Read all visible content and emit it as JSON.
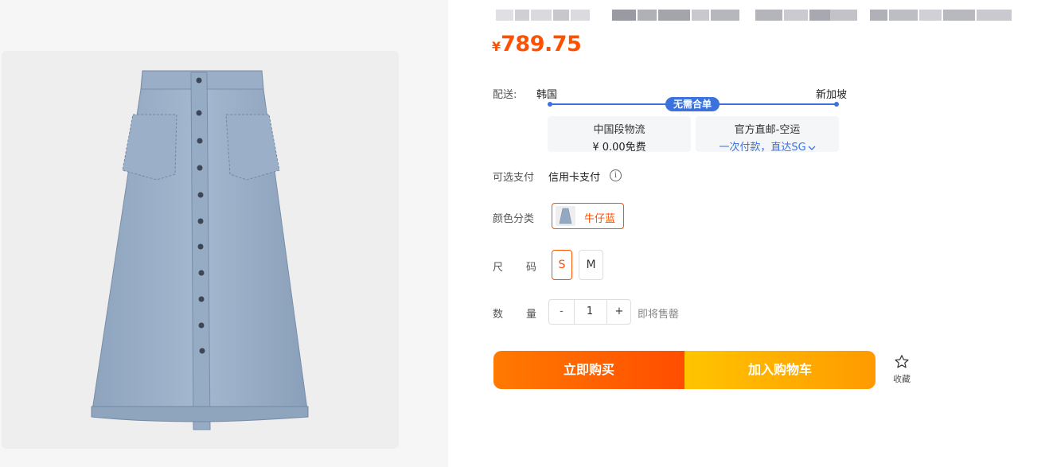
{
  "product": {
    "price_currency": "¥",
    "price_value": "789.75"
  },
  "shipping": {
    "label": "配送:",
    "origin": "韩国",
    "destination": "新加坡",
    "badge": "无需合单",
    "option1_title": "中国段物流",
    "option1_detail": "¥ 0.00免费",
    "option2_title": "官方直邮-空运",
    "option2_detail": "一次付款，直达SG"
  },
  "payment": {
    "label": "可选支付",
    "method": "信用卡支付",
    "info_icon": "info-circle-icon"
  },
  "color": {
    "label": "颜色分类",
    "selected": "牛仔蓝"
  },
  "size": {
    "label_part1": "尺",
    "label_part2": "码",
    "options": [
      "S",
      "M"
    ],
    "selected": "S"
  },
  "quantity": {
    "label_part1": "数",
    "label_part2": "量",
    "minus": "-",
    "value": "1",
    "plus": "+",
    "stock_note": "即将售罄"
  },
  "actions": {
    "buy_now": "立即购买",
    "add_to_cart": "加入购物车",
    "favorite": "收藏"
  },
  "colors": {
    "accent": "#ff5000",
    "link_blue": "#3b72dd",
    "buy_gradient": [
      "#ff7a00",
      "#ff4d00"
    ],
    "cart_gradient": [
      "#ffc400",
      "#ff9a00"
    ]
  }
}
